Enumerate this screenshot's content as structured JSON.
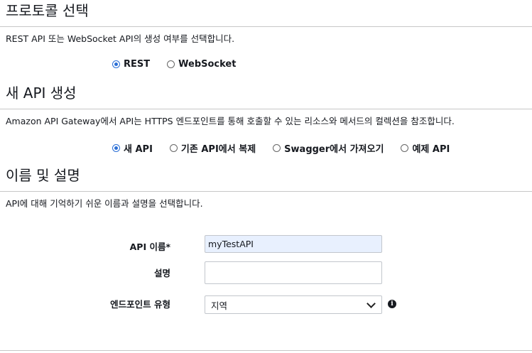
{
  "protocol": {
    "title": "프로토콜 선택",
    "description": "REST API 또는 WebSocket API의 생성 여부를 선택합니다.",
    "options": [
      {
        "label": "REST",
        "checked": true
      },
      {
        "label": "WebSocket",
        "checked": false
      }
    ]
  },
  "new_api": {
    "title": "새 API 생성",
    "description": "Amazon API Gateway에서 API는 HTTPS 엔드포인트를 통해 호출할 수 있는 리소스와 메서드의 컬렉션을 참조합니다.",
    "options": [
      {
        "label": "새 API",
        "checked": true
      },
      {
        "label": "기존 API에서 복제",
        "checked": false
      },
      {
        "label": "Swagger에서 가져오기",
        "checked": false
      },
      {
        "label": "예제 API",
        "checked": false
      }
    ]
  },
  "name_desc": {
    "title": "이름 및 설명",
    "description": "API에 대해 기억하기 쉬운 이름과 설명을 선택합니다.",
    "api_name_label": "API 이름*",
    "api_name_value": "myTestAPI",
    "description_label": "설명",
    "description_value": "",
    "endpoint_label": "엔드포인트 유형",
    "endpoint_value": "지역",
    "info_icon": "info-icon"
  },
  "colors": {
    "accent": "#2b6fd6",
    "autofill_bg": "#e8f0fe",
    "divider": "#c7c7c7"
  }
}
